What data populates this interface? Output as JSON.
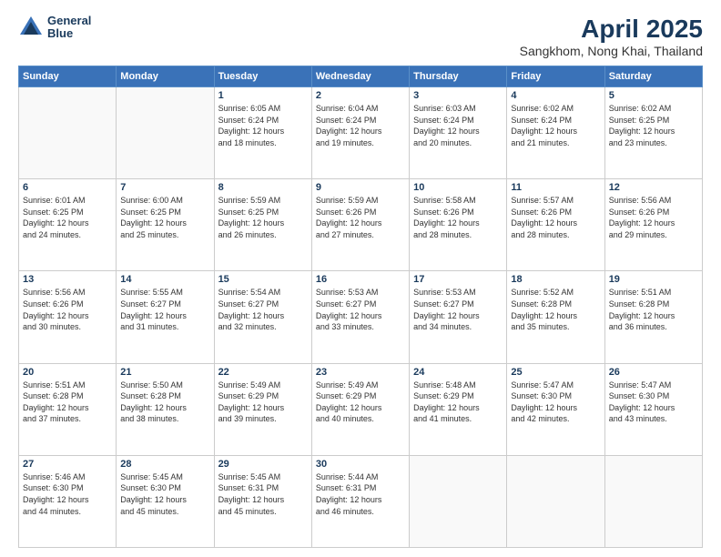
{
  "header": {
    "logo_line1": "General",
    "logo_line2": "Blue",
    "title": "April 2025",
    "subtitle": "Sangkhom, Nong Khai, Thailand"
  },
  "days_of_week": [
    "Sunday",
    "Monday",
    "Tuesday",
    "Wednesday",
    "Thursday",
    "Friday",
    "Saturday"
  ],
  "weeks": [
    [
      {
        "day": "",
        "info": ""
      },
      {
        "day": "",
        "info": ""
      },
      {
        "day": "1",
        "info": "Sunrise: 6:05 AM\nSunset: 6:24 PM\nDaylight: 12 hours\nand 18 minutes."
      },
      {
        "day": "2",
        "info": "Sunrise: 6:04 AM\nSunset: 6:24 PM\nDaylight: 12 hours\nand 19 minutes."
      },
      {
        "day": "3",
        "info": "Sunrise: 6:03 AM\nSunset: 6:24 PM\nDaylight: 12 hours\nand 20 minutes."
      },
      {
        "day": "4",
        "info": "Sunrise: 6:02 AM\nSunset: 6:24 PM\nDaylight: 12 hours\nand 21 minutes."
      },
      {
        "day": "5",
        "info": "Sunrise: 6:02 AM\nSunset: 6:25 PM\nDaylight: 12 hours\nand 23 minutes."
      }
    ],
    [
      {
        "day": "6",
        "info": "Sunrise: 6:01 AM\nSunset: 6:25 PM\nDaylight: 12 hours\nand 24 minutes."
      },
      {
        "day": "7",
        "info": "Sunrise: 6:00 AM\nSunset: 6:25 PM\nDaylight: 12 hours\nand 25 minutes."
      },
      {
        "day": "8",
        "info": "Sunrise: 5:59 AM\nSunset: 6:25 PM\nDaylight: 12 hours\nand 26 minutes."
      },
      {
        "day": "9",
        "info": "Sunrise: 5:59 AM\nSunset: 6:26 PM\nDaylight: 12 hours\nand 27 minutes."
      },
      {
        "day": "10",
        "info": "Sunrise: 5:58 AM\nSunset: 6:26 PM\nDaylight: 12 hours\nand 28 minutes."
      },
      {
        "day": "11",
        "info": "Sunrise: 5:57 AM\nSunset: 6:26 PM\nDaylight: 12 hours\nand 28 minutes."
      },
      {
        "day": "12",
        "info": "Sunrise: 5:56 AM\nSunset: 6:26 PM\nDaylight: 12 hours\nand 29 minutes."
      }
    ],
    [
      {
        "day": "13",
        "info": "Sunrise: 5:56 AM\nSunset: 6:26 PM\nDaylight: 12 hours\nand 30 minutes."
      },
      {
        "day": "14",
        "info": "Sunrise: 5:55 AM\nSunset: 6:27 PM\nDaylight: 12 hours\nand 31 minutes."
      },
      {
        "day": "15",
        "info": "Sunrise: 5:54 AM\nSunset: 6:27 PM\nDaylight: 12 hours\nand 32 minutes."
      },
      {
        "day": "16",
        "info": "Sunrise: 5:53 AM\nSunset: 6:27 PM\nDaylight: 12 hours\nand 33 minutes."
      },
      {
        "day": "17",
        "info": "Sunrise: 5:53 AM\nSunset: 6:27 PM\nDaylight: 12 hours\nand 34 minutes."
      },
      {
        "day": "18",
        "info": "Sunrise: 5:52 AM\nSunset: 6:28 PM\nDaylight: 12 hours\nand 35 minutes."
      },
      {
        "day": "19",
        "info": "Sunrise: 5:51 AM\nSunset: 6:28 PM\nDaylight: 12 hours\nand 36 minutes."
      }
    ],
    [
      {
        "day": "20",
        "info": "Sunrise: 5:51 AM\nSunset: 6:28 PM\nDaylight: 12 hours\nand 37 minutes."
      },
      {
        "day": "21",
        "info": "Sunrise: 5:50 AM\nSunset: 6:28 PM\nDaylight: 12 hours\nand 38 minutes."
      },
      {
        "day": "22",
        "info": "Sunrise: 5:49 AM\nSunset: 6:29 PM\nDaylight: 12 hours\nand 39 minutes."
      },
      {
        "day": "23",
        "info": "Sunrise: 5:49 AM\nSunset: 6:29 PM\nDaylight: 12 hours\nand 40 minutes."
      },
      {
        "day": "24",
        "info": "Sunrise: 5:48 AM\nSunset: 6:29 PM\nDaylight: 12 hours\nand 41 minutes."
      },
      {
        "day": "25",
        "info": "Sunrise: 5:47 AM\nSunset: 6:30 PM\nDaylight: 12 hours\nand 42 minutes."
      },
      {
        "day": "26",
        "info": "Sunrise: 5:47 AM\nSunset: 6:30 PM\nDaylight: 12 hours\nand 43 minutes."
      }
    ],
    [
      {
        "day": "27",
        "info": "Sunrise: 5:46 AM\nSunset: 6:30 PM\nDaylight: 12 hours\nand 44 minutes."
      },
      {
        "day": "28",
        "info": "Sunrise: 5:45 AM\nSunset: 6:30 PM\nDaylight: 12 hours\nand 45 minutes."
      },
      {
        "day": "29",
        "info": "Sunrise: 5:45 AM\nSunset: 6:31 PM\nDaylight: 12 hours\nand 45 minutes."
      },
      {
        "day": "30",
        "info": "Sunrise: 5:44 AM\nSunset: 6:31 PM\nDaylight: 12 hours\nand 46 minutes."
      },
      {
        "day": "",
        "info": ""
      },
      {
        "day": "",
        "info": ""
      },
      {
        "day": "",
        "info": ""
      }
    ]
  ]
}
